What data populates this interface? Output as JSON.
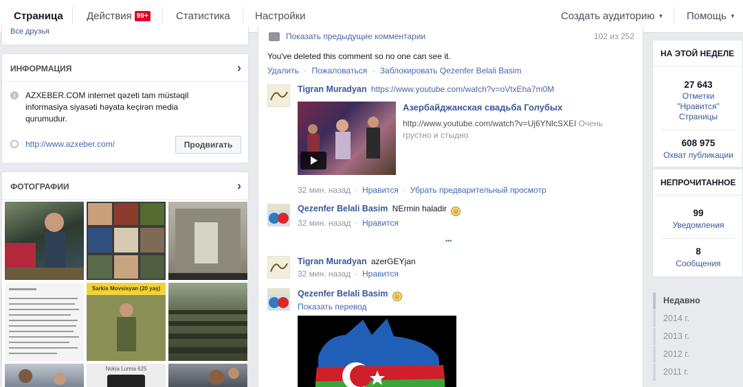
{
  "nav": {
    "tabs": [
      {
        "label": "Страница"
      },
      {
        "label": "Действия",
        "badge": "99+"
      },
      {
        "label": "Статистика"
      },
      {
        "label": "Настройки"
      }
    ],
    "create_audience": "Создать аудиторию",
    "help": "Помощь"
  },
  "left": {
    "cut_text": "Все друзья",
    "info": {
      "title": "ИНФОРМАЦИЯ",
      "about": "AZXEBER.COM internet qəzeti tam müstəqil informasiya siyasəti həyata keçirən media qurumudur.",
      "website": "http://www.azxeber.com/",
      "promote_button": "Продвигать"
    },
    "photos": {
      "title": "ФОТОГРАФИИ",
      "label_banner": "Sarkis Movsisyan (20 yaş)",
      "label_phone": "Nokia Lumia 625"
    }
  },
  "feed": {
    "prev_comments": "Показать предыдущие комментарии",
    "count": "102 из 252",
    "deleted_text": "You've deleted this comment so no one can see it.",
    "actions": {
      "delete": "Удалить",
      "report": "Пожаловаться",
      "block": "Заблокировать Qezenfer Belali Basim"
    },
    "comments": [
      {
        "author": "Tigran Muradyan",
        "text": "https://www.youtube.com/watch?v=oVtxEha7m0M",
        "preview": {
          "title": "Азербайджанская свадьба Голубых",
          "url": "http://www.youtube.com/watch?v=Uj6YNlcSXEI",
          "desc_a": "Очень",
          "desc_b": "грустно и стыдно"
        },
        "time": "32 мин. назад",
        "like": "Нравится",
        "remove_preview": "Убрать предварительный просмотр"
      },
      {
        "author": "Qezenfer Belali Basim",
        "text": "NErmin haladir",
        "time": "32 мин. назад",
        "like": "Нравится"
      },
      {
        "author": "Tigran Muradyan",
        "text": "azerGEYjan",
        "time": "32 мин. назад",
        "like": "Нравится"
      },
      {
        "author": "Qezenfer Belali Basim",
        "translate": "Показать перевод"
      }
    ],
    "more_dots": "•••"
  },
  "right": {
    "this_week": {
      "title": "НА ЭТОЙ НЕДЕЛЕ",
      "likes_num": "27 643",
      "likes_lbl_1": "Отметки",
      "likes_lbl_2": "\"Нравится\"",
      "likes_lbl_3": "Страницы",
      "reach_num": "608 975",
      "reach_lbl": "Охват публикации"
    },
    "unread": {
      "title": "НЕПРОЧИТАННОЕ",
      "notif_num": "99",
      "notif_lbl": "Уведомления",
      "msg_num": "8",
      "msg_lbl": "Сообщения"
    },
    "years": [
      "Недавно",
      "2014 г.",
      "2013 г.",
      "2012 г.",
      "2011 г."
    ]
  },
  "colors": {
    "accent": "#4267b2",
    "link": "#365899",
    "badge": "#e0002a"
  }
}
